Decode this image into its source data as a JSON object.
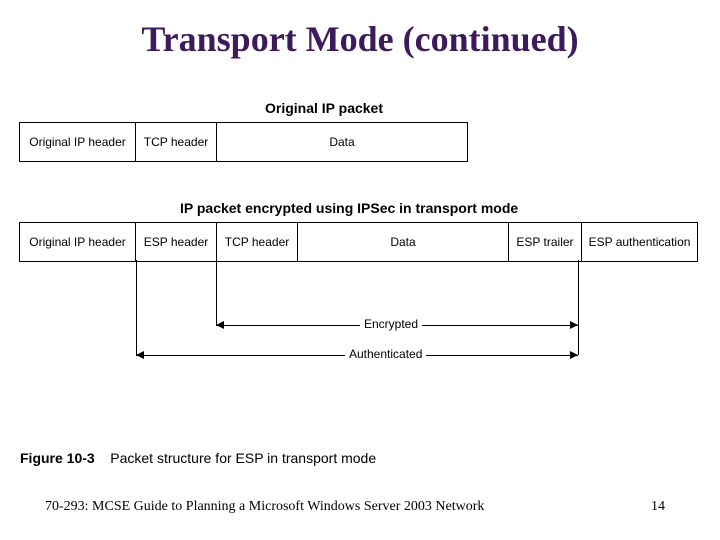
{
  "title": "Transport Mode (continued)",
  "figure": {
    "orig_label": "Original IP packet",
    "orig_cells": {
      "ip": "Original IP header",
      "tcp": "TCP header",
      "data": "Data"
    },
    "ipsec_label": "IP packet encrypted using IPSec in transport mode",
    "ipsec_cells": {
      "ip": "Original IP header",
      "esp_h": "ESP header",
      "tcp": "TCP header",
      "data": "Data",
      "esp_t": "ESP trailer",
      "esp_a": "ESP authentication"
    },
    "bracket_encrypted": "Encrypted",
    "bracket_auth": "Authenticated",
    "caption_bold": "Figure 10-3",
    "caption_rest": "Packet structure for ESP in transport mode"
  },
  "footer_left": "70-293: MCSE Guide to Planning a Microsoft Windows Server 2003 Network",
  "footer_right": "14"
}
